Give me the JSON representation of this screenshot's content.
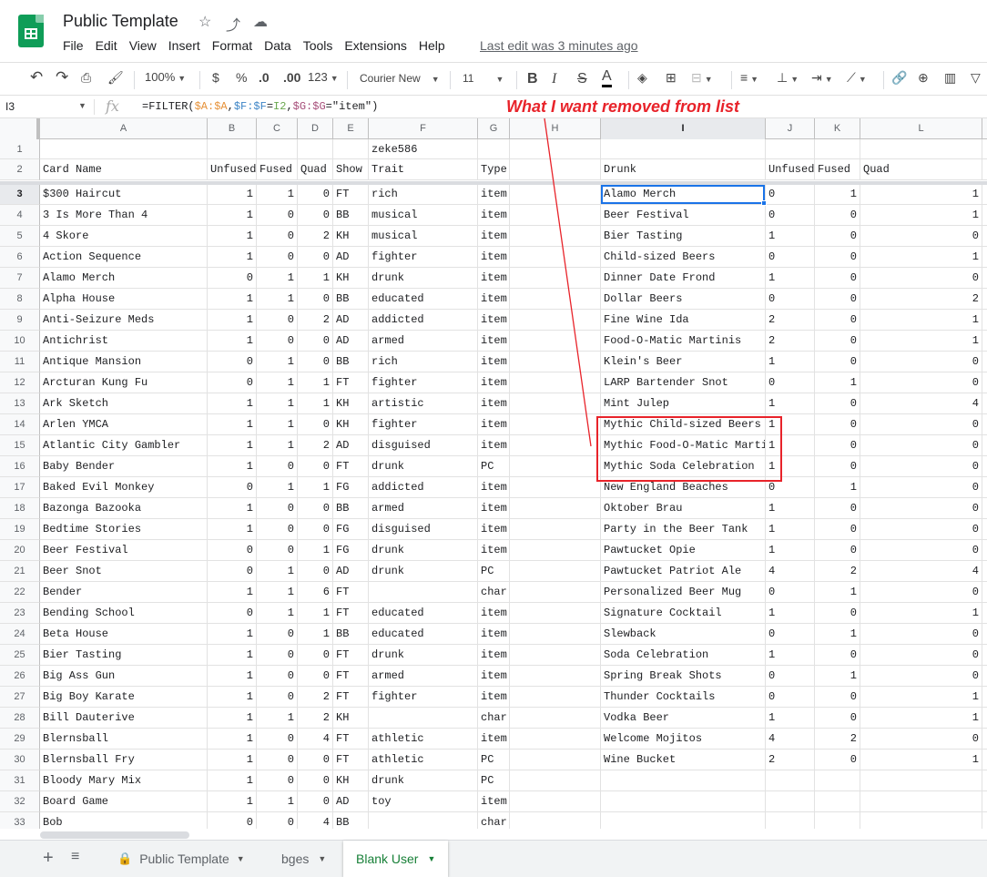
{
  "app": {
    "doc_title": "Public Template",
    "star_icon": "☆",
    "move_icon": "⤴",
    "cloud_icon": "☁",
    "last_edit": "Last edit was 3 minutes ago",
    "menu": [
      "File",
      "Edit",
      "View",
      "Insert",
      "Format",
      "Data",
      "Tools",
      "Extensions",
      "Help"
    ]
  },
  "toolbar": {
    "zoom": "100%",
    "currency": "$",
    "percent": "%",
    "dec_decrease": ".0",
    "dec_increase": ".00",
    "more_formats": "123",
    "font": "Courier New",
    "font_size": "11",
    "bold": "B",
    "italic": "I",
    "strike": "S",
    "text_color": "A"
  },
  "formula_bar": {
    "name_box": "I3",
    "fx": "fx",
    "formula_parts": [
      "=FILTER(",
      "$A:$A",
      ",",
      "$F:$F",
      "=",
      "I2",
      ",",
      "$G:$G",
      "=\"item\")"
    ]
  },
  "annotation": "What I  want removed from list",
  "columns": [
    "A",
    "B",
    "C",
    "D",
    "E",
    "F",
    "G",
    "H",
    "I",
    "J",
    "K",
    "L"
  ],
  "rows": [
    {
      "n": "1",
      "A": "",
      "B": "",
      "C": "",
      "D": "",
      "E": "",
      "F": "zeke586",
      "G": "",
      "I": "",
      "J": "",
      "K": "",
      "L": ""
    },
    {
      "n": "2",
      "A": "Card Name",
      "B": "Unfused",
      "C": "Fused",
      "D": "Quad",
      "E": "Show",
      "F": "Trait",
      "G": "Type",
      "I": "Drunk",
      "J": "Unfused",
      "K": "Fused",
      "L": "Quad"
    },
    {
      "n": "3",
      "A": "$300 Haircut",
      "B": "1",
      "C": "1",
      "D": "0",
      "E": "FT",
      "F": "rich",
      "G": "item",
      "I": "Alamo Merch",
      "J": "0",
      "K": "1",
      "L": "1"
    },
    {
      "n": "4",
      "A": "3 Is More Than 4",
      "B": "1",
      "C": "0",
      "D": "0",
      "E": "BB",
      "F": "musical",
      "G": "item",
      "I": "Beer Festival",
      "J": "0",
      "K": "0",
      "L": "1"
    },
    {
      "n": "5",
      "A": "4 Skore",
      "B": "1",
      "C": "0",
      "D": "2",
      "E": "KH",
      "F": "musical",
      "G": "item",
      "I": "Bier Tasting",
      "J": "1",
      "K": "0",
      "L": "0"
    },
    {
      "n": "6",
      "A": "Action Sequence",
      "B": "1",
      "C": "0",
      "D": "0",
      "E": "AD",
      "F": "fighter",
      "G": "item",
      "I": "Child-sized Beers",
      "J": "0",
      "K": "0",
      "L": "1"
    },
    {
      "n": "7",
      "A": "Alamo Merch",
      "B": "0",
      "C": "1",
      "D": "1",
      "E": "KH",
      "F": "drunk",
      "G": "item",
      "I": "Dinner Date Frond",
      "J": "1",
      "K": "0",
      "L": "0"
    },
    {
      "n": "8",
      "A": "Alpha House",
      "B": "1",
      "C": "1",
      "D": "0",
      "E": "BB",
      "F": "educated",
      "G": "item",
      "I": "Dollar Beers",
      "J": "0",
      "K": "0",
      "L": "2"
    },
    {
      "n": "9",
      "A": "Anti-Seizure Meds",
      "B": "1",
      "C": "0",
      "D": "2",
      "E": "AD",
      "F": "addicted",
      "G": "item",
      "I": "Fine Wine Ida",
      "J": "2",
      "K": "0",
      "L": "1"
    },
    {
      "n": "10",
      "A": "Antichrist",
      "B": "1",
      "C": "0",
      "D": "0",
      "E": "AD",
      "F": "armed",
      "G": "item",
      "I": "Food-O-Matic Martinis",
      "J": "2",
      "K": "0",
      "L": "1"
    },
    {
      "n": "11",
      "A": "Antique Mansion",
      "B": "0",
      "C": "1",
      "D": "0",
      "E": "BB",
      "F": "rich",
      "G": "item",
      "I": "Klein's Beer",
      "J": "1",
      "K": "0",
      "L": "0"
    },
    {
      "n": "12",
      "A": "Arcturan Kung Fu",
      "B": "0",
      "C": "1",
      "D": "1",
      "E": "FT",
      "F": "fighter",
      "G": "item",
      "I": "LARP Bartender Snot",
      "J": "0",
      "K": "1",
      "L": "0"
    },
    {
      "n": "13",
      "A": "Ark Sketch",
      "B": "1",
      "C": "1",
      "D": "1",
      "E": "KH",
      "F": "artistic",
      "G": "item",
      "I": "Mint Julep",
      "J": "1",
      "K": "0",
      "L": "4"
    },
    {
      "n": "14",
      "A": "Arlen YMCA",
      "B": "1",
      "C": "1",
      "D": "0",
      "E": "KH",
      "F": "fighter",
      "G": "item",
      "I": "Mythic Child-sized Beers",
      "J": "1",
      "K": "0",
      "L": "0"
    },
    {
      "n": "15",
      "A": "Atlantic City Gambler",
      "B": "1",
      "C": "1",
      "D": "2",
      "E": "AD",
      "F": "disguised",
      "G": "item",
      "I": "Mythic Food-O-Matic Martinis",
      "J": "1",
      "K": "0",
      "L": "0"
    },
    {
      "n": "16",
      "A": "Baby Bender",
      "B": "1",
      "C": "0",
      "D": "0",
      "E": "FT",
      "F": "drunk",
      "G": "PC",
      "I": "Mythic Soda Celebration",
      "J": "1",
      "K": "0",
      "L": "0"
    },
    {
      "n": "17",
      "A": "Baked Evil Monkey",
      "B": "0",
      "C": "1",
      "D": "1",
      "E": "FG",
      "F": "addicted",
      "G": "item",
      "I": "New England Beaches",
      "J": "0",
      "K": "1",
      "L": "0"
    },
    {
      "n": "18",
      "A": "Bazonga Bazooka",
      "B": "1",
      "C": "0",
      "D": "0",
      "E": "BB",
      "F": "armed",
      "G": "item",
      "I": "Oktober Brau",
      "J": "1",
      "K": "0",
      "L": "0"
    },
    {
      "n": "19",
      "A": "Bedtime Stories",
      "B": "1",
      "C": "0",
      "D": "0",
      "E": "FG",
      "F": "disguised",
      "G": "item",
      "I": "Party in the Beer Tank",
      "J": "1",
      "K": "0",
      "L": "0"
    },
    {
      "n": "20",
      "A": "Beer Festival",
      "B": "0",
      "C": "0",
      "D": "1",
      "E": "FG",
      "F": "drunk",
      "G": "item",
      "I": "Pawtucket Opie",
      "J": "1",
      "K": "0",
      "L": "0"
    },
    {
      "n": "21",
      "A": "Beer Snot",
      "B": "0",
      "C": "1",
      "D": "0",
      "E": "AD",
      "F": "drunk",
      "G": "PC",
      "I": "Pawtucket Patriot Ale",
      "J": "4",
      "K": "2",
      "L": "4"
    },
    {
      "n": "22",
      "A": "Bender",
      "B": "1",
      "C": "1",
      "D": "6",
      "E": "FT",
      "F": "",
      "G": "char",
      "I": "Personalized Beer Mug",
      "J": "0",
      "K": "1",
      "L": "0"
    },
    {
      "n": "23",
      "A": "Bending School",
      "B": "0",
      "C": "1",
      "D": "1",
      "E": "FT",
      "F": "educated",
      "G": "item",
      "I": "Signature Cocktail",
      "J": "1",
      "K": "0",
      "L": "1"
    },
    {
      "n": "24",
      "A": "Beta House",
      "B": "1",
      "C": "0",
      "D": "1",
      "E": "BB",
      "F": "educated",
      "G": "item",
      "I": "Slewback",
      "J": "0",
      "K": "1",
      "L": "0"
    },
    {
      "n": "25",
      "A": "Bier Tasting",
      "B": "1",
      "C": "0",
      "D": "0",
      "E": "FT",
      "F": "drunk",
      "G": "item",
      "I": "Soda Celebration",
      "J": "1",
      "K": "0",
      "L": "0"
    },
    {
      "n": "26",
      "A": "Big Ass Gun",
      "B": "1",
      "C": "0",
      "D": "0",
      "E": "FT",
      "F": "armed",
      "G": "item",
      "I": "Spring Break Shots",
      "J": "0",
      "K": "1",
      "L": "0"
    },
    {
      "n": "27",
      "A": "Big Boy Karate",
      "B": "1",
      "C": "0",
      "D": "2",
      "E": "FT",
      "F": "fighter",
      "G": "item",
      "I": "Thunder Cocktails",
      "J": "0",
      "K": "0",
      "L": "1"
    },
    {
      "n": "28",
      "A": "Bill Dauterive",
      "B": "1",
      "C": "1",
      "D": "2",
      "E": "KH",
      "F": "",
      "G": "char",
      "I": "Vodka Beer",
      "J": "1",
      "K": "0",
      "L": "1"
    },
    {
      "n": "29",
      "A": "Blernsball",
      "B": "1",
      "C": "0",
      "D": "4",
      "E": "FT",
      "F": "athletic",
      "G": "item",
      "I": "Welcome Mojitos",
      "J": "4",
      "K": "2",
      "L": "0"
    },
    {
      "n": "30",
      "A": "Blernsball Fry",
      "B": "1",
      "C": "0",
      "D": "0",
      "E": "FT",
      "F": "athletic",
      "G": "PC",
      "I": "Wine Bucket",
      "J": "2",
      "K": "0",
      "L": "1"
    },
    {
      "n": "31",
      "A": "Bloody Mary Mix",
      "B": "1",
      "C": "0",
      "D": "0",
      "E": "KH",
      "F": "drunk",
      "G": "PC",
      "I": "",
      "J": "",
      "K": "",
      "L": ""
    },
    {
      "n": "32",
      "A": "Board Game",
      "B": "1",
      "C": "1",
      "D": "0",
      "E": "AD",
      "F": "toy",
      "G": "item",
      "I": "",
      "J": "",
      "K": "",
      "L": ""
    },
    {
      "n": "33",
      "A": "Bob",
      "B": "0",
      "C": "0",
      "D": "4",
      "E": "BB",
      "F": "",
      "G": "char",
      "I": "",
      "J": "",
      "K": "",
      "L": ""
    }
  ],
  "sheet_tabs": [
    {
      "label": "Public Template",
      "locked": true,
      "active": false
    },
    {
      "label": "bges",
      "locked": false,
      "active": false
    },
    {
      "label": "Blank User",
      "locked": false,
      "active": true
    }
  ],
  "colors": {
    "accent_green": "#188038",
    "selection_blue": "#1a73e8",
    "annotation_red": "#e8232a"
  }
}
